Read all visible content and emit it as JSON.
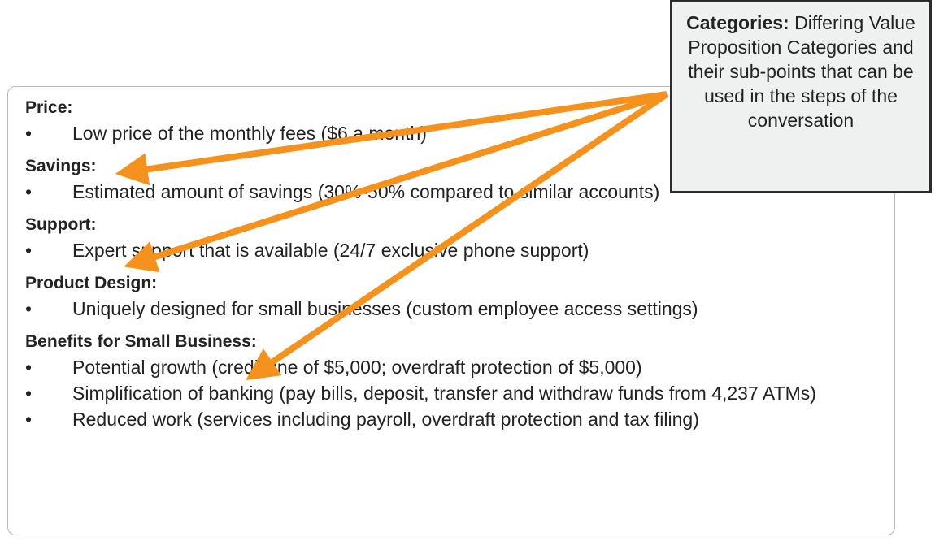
{
  "callout": {
    "title": "Categories:",
    "text": "Differing Value Proposition Categories and their sub-points that can be used in the steps of the conversation"
  },
  "categories": [
    {
      "title": "Price:",
      "points": [
        "Low price of the monthly fees ($6 a month)"
      ]
    },
    {
      "title": "Savings:",
      "points": [
        "Estimated amount of savings (30%-50% compared to similar accounts)"
      ]
    },
    {
      "title": "Support:",
      "points": [
        "Expert support that is available (24/7 exclusive phone support)"
      ]
    },
    {
      "title": "Product Design:",
      "points": [
        "Uniquely designed for small businesses (custom employee access settings)"
      ]
    },
    {
      "title": "Benefits for Small Business:",
      "points": [
        "Potential growth (credit line of $5,000; overdraft protection of $5,000)",
        "Simplification of banking (pay bills, deposit, transfer and withdraw funds from 4,237 ATMs)",
        "Reduced work (services including payroll, overdraft protection and tax filing)"
      ]
    }
  ],
  "colors": {
    "arrow": "#f5921e",
    "callout_bg": "#eef1ef",
    "callout_border": "#2b2b2b",
    "panel_border": "#b9b9b9"
  }
}
